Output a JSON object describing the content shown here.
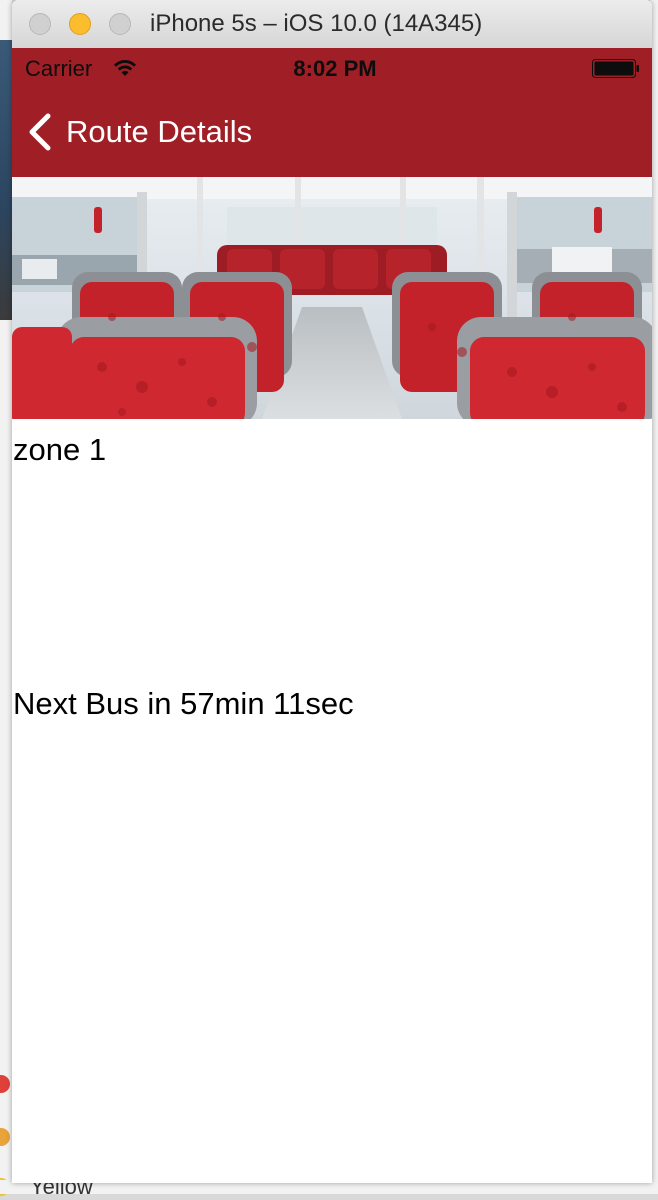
{
  "window": {
    "title": "iPhone 5s – iOS 10.0 (14A345)"
  },
  "status_bar": {
    "carrier": "Carrier",
    "time": "8:02 PM"
  },
  "nav": {
    "back_label": "Route Details"
  },
  "route": {
    "zone": "zone 1",
    "next_bus": "Next Bus in 57min 11sec"
  },
  "background": {
    "bottom_word": "Yellow"
  },
  "colors": {
    "nav_bar": "#a01f26",
    "minimize_button": "#fbbd2e",
    "seat_red": "#c4222a"
  },
  "icons": {
    "back": "chevron-left-icon",
    "wifi": "wifi-icon",
    "battery": "battery-icon"
  }
}
